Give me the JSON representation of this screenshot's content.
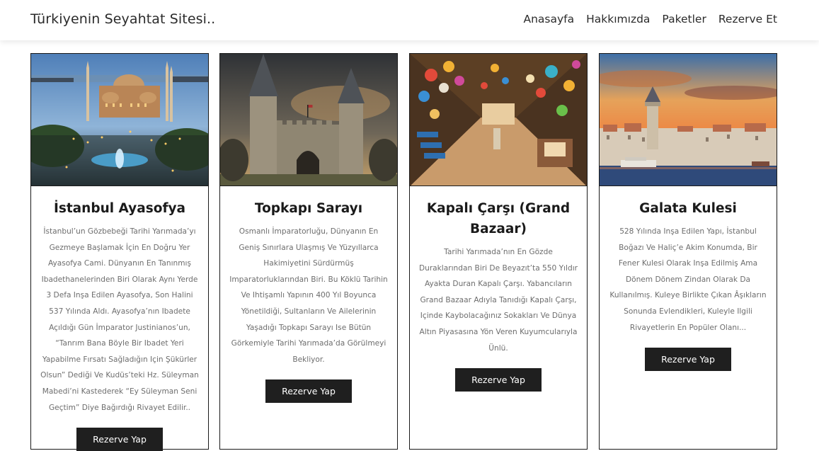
{
  "navbar": {
    "brand": "Türkiyenin Seyahtat Sitesi..",
    "links": [
      "Anasayfa",
      "Hakkımızda",
      "Paketler",
      "Rezerve Et"
    ]
  },
  "cards": [
    {
      "title": "İstanbul Ayasofya",
      "description": "İstanbul’un Gözbebeği Tarihi Yarımada’yı Gezmeye Başlamak İçin En Doğru Yer Ayasofya Cami. Dünyanın En Tanınmış Ibadethanelerinden Biri Olarak Aynı Yerde 3 Defa Inşa Edilen Ayasofya, Son Halini 537 Yılında Aldı. Ayasofya’nın Ibadete Açıldığı Gün İmparator Justinianos’un, “Tanrım Bana Böyle Bir Ibadet Yeri Yapabilme Fırsatı Sağladığın Için Şükürler Olsun” Dediği Ve Kudüs’teki Hz. Süleyman Mabedi’ni Kastederek “Ey Süleyman Seni Geçtim” Diye Bağırdığı Rivayet Edilir..",
      "button": "Rezerve Yap",
      "image_icon": "hagia-sophia-photo"
    },
    {
      "title": "Topkapı Sarayı",
      "description": "Osmanlı İmparatorluğu, Dünyanın En Geniş Sınırlara Ulaşmış Ve Yüzyıllarca Hakimiyetini Sürdürmüş Imparatorluklarından Biri. Bu Köklü Tarihin Ve Ihtişamlı Yapının 400 Yıl Boyunca Yönetildiği, Sultanların Ve Ailelerinin Yaşadığı Topkapı Sarayı Ise Bütün Görkemiyle Tarihi Yarımada’da Görülmeyi Bekliyor.",
      "button": "Rezerve Yap",
      "image_icon": "topkapi-gate-photo"
    },
    {
      "title": "Kapalı Çarşı (Grand Bazaar)",
      "description": "Tarihi Yarımada’nın En Gözde Duraklarından Biri De Beyazıt’ta 550 Yıldır Ayakta Duran Kapalı Çarşı. Yabancıların Grand Bazaar Adıyla Tanıdığı Kapalı Çarşı, Içinde Kaybolacağınız Sokakları Ve Dünya Altın Piyasasına Yön Veren Kuyumcularıyla Ünlü.",
      "button": "Rezerve Yap",
      "image_icon": "grand-bazaar-photo"
    },
    {
      "title": "Galata Kulesi",
      "description": "528 Yılında Inşa Edilen Yapı, İstanbul Boğazı Ve Haliç’e Akim Konumda, Bir Fener Kulesi Olarak Inşa Edilmiş Ama Dönem Dönem Zindan Olarak Da Kullanılmış. Kuleye Birlikte Çıkan Âşıkların Sonunda Evlendikleri, Kuleyle Ilgili Rivayetlerin En Popüler Olanı...",
      "button": "Rezerve Yap",
      "image_icon": "galata-tower-photo"
    }
  ]
}
